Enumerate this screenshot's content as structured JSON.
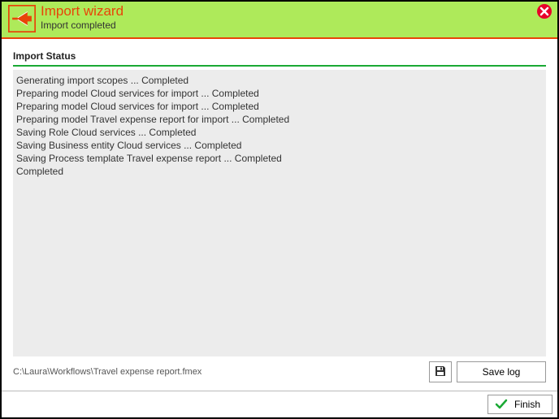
{
  "header": {
    "title": "Import wizard",
    "subtitle": "Import completed"
  },
  "section_title": "Import Status",
  "log_lines": [
    "Generating import scopes ... Completed",
    "Preparing model Cloud services for import ... Completed",
    "Preparing model Cloud services for import ... Completed",
    "Preparing model Travel expense report for import ... Completed",
    "Saving Role Cloud services ... Completed",
    "Saving Business entity Cloud services ... Completed",
    "Saving Process template Travel expense report ... Completed",
    " Completed"
  ],
  "file_path": "C:\\Laura\\Workflows\\Travel expense report.fmex",
  "buttons": {
    "save_log": "Save log",
    "finish": "Finish"
  }
}
